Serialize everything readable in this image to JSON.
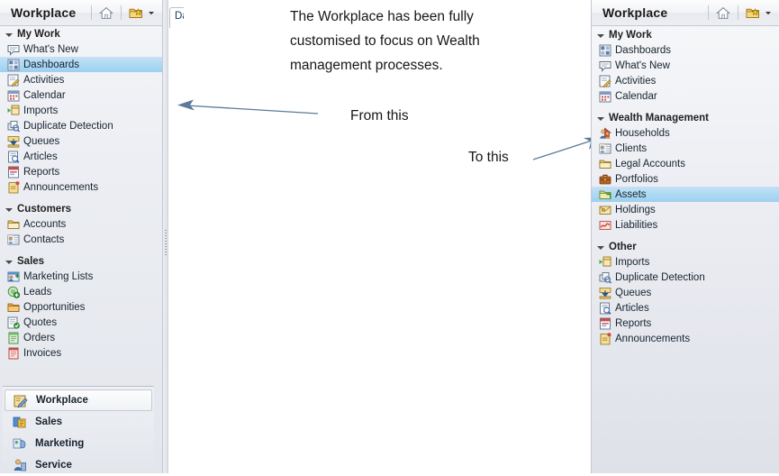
{
  "annotations": {
    "headline": "The Workplace has been fully\ncustomised to focus on Wealth\nmanagement processes.",
    "from_label": "From this",
    "to_label": "To this",
    "arrow_color": "#5b7b99"
  },
  "content_tab": {
    "label": "Dashboards"
  },
  "left_pane": {
    "header": {
      "title": "Workplace",
      "home_icon": "home-icon",
      "pin_icon": "pin-view-icon",
      "dropdown_icon": "chevron-down-icon"
    },
    "groups": [
      {
        "label": "My Work",
        "expanded": true,
        "items": [
          {
            "label": "What's New",
            "icon": "speech-bubble-icon",
            "selected": false
          },
          {
            "label": "Dashboards",
            "icon": "dashboard-grid-icon",
            "selected": true
          },
          {
            "label": "Activities",
            "icon": "activity-pencil-icon",
            "selected": false
          },
          {
            "label": "Calendar",
            "icon": "calendar-icon",
            "selected": false
          },
          {
            "label": "Imports",
            "icon": "import-icon",
            "selected": false
          },
          {
            "label": "Duplicate Detection",
            "icon": "duplicate-detection-icon",
            "selected": false
          },
          {
            "label": "Queues",
            "icon": "queues-icon",
            "selected": false
          },
          {
            "label": "Articles",
            "icon": "articles-icon",
            "selected": false
          },
          {
            "label": "Reports",
            "icon": "reports-icon",
            "selected": false
          },
          {
            "label": "Announcements",
            "icon": "announcements-icon",
            "selected": false
          }
        ]
      },
      {
        "label": "Customers",
        "expanded": true,
        "items": [
          {
            "label": "Accounts",
            "icon": "folder-accounts-icon",
            "selected": false
          },
          {
            "label": "Contacts",
            "icon": "contact-card-icon",
            "selected": false
          }
        ]
      },
      {
        "label": "Sales",
        "expanded": true,
        "items": [
          {
            "label": "Marketing Lists",
            "icon": "marketing-list-icon",
            "selected": false
          },
          {
            "label": "Leads",
            "icon": "leads-icon",
            "selected": false
          },
          {
            "label": "Opportunities",
            "icon": "opportunities-icon",
            "selected": false
          },
          {
            "label": "Quotes",
            "icon": "quotes-icon",
            "selected": false
          },
          {
            "label": "Orders",
            "icon": "orders-icon",
            "selected": false
          },
          {
            "label": "Invoices",
            "icon": "invoices-icon",
            "selected": false
          }
        ]
      }
    ],
    "launcher": [
      {
        "label": "Workplace",
        "icon": "workplace-icon",
        "selected": true
      },
      {
        "label": "Sales",
        "icon": "sales-module-icon",
        "selected": false
      },
      {
        "label": "Marketing",
        "icon": "marketing-module-icon",
        "selected": false
      },
      {
        "label": "Service",
        "icon": "service-module-icon",
        "selected": false
      }
    ]
  },
  "right_pane": {
    "header": {
      "title": "Workplace",
      "home_icon": "home-icon",
      "pin_icon": "pin-view-icon",
      "dropdown_icon": "chevron-down-icon"
    },
    "groups": [
      {
        "label": "My Work",
        "expanded": true,
        "items": [
          {
            "label": "Dashboards",
            "icon": "dashboard-grid-icon",
            "selected": false
          },
          {
            "label": "What's New",
            "icon": "speech-bubble-icon",
            "selected": false
          },
          {
            "label": "Activities",
            "icon": "activity-pencil-icon",
            "selected": false
          },
          {
            "label": "Calendar",
            "icon": "calendar-icon",
            "selected": false
          }
        ]
      },
      {
        "label": "Wealth Management",
        "expanded": true,
        "items": [
          {
            "label": "Households",
            "icon": "households-icon",
            "selected": false
          },
          {
            "label": "Clients",
            "icon": "contact-card-icon",
            "selected": false
          },
          {
            "label": "Legal Accounts",
            "icon": "folder-accounts-icon",
            "selected": false
          },
          {
            "label": "Portfolios",
            "icon": "portfolios-icon",
            "selected": false
          },
          {
            "label": "Assets",
            "icon": "assets-icon",
            "selected": true
          },
          {
            "label": "Holdings",
            "icon": "holdings-icon",
            "selected": false
          },
          {
            "label": "Liabilities",
            "icon": "liabilities-icon",
            "selected": false
          }
        ]
      },
      {
        "label": "Other",
        "expanded": true,
        "items": [
          {
            "label": "Imports",
            "icon": "import-icon",
            "selected": false
          },
          {
            "label": "Duplicate Detection",
            "icon": "duplicate-detection-icon",
            "selected": false
          },
          {
            "label": "Queues",
            "icon": "queues-icon",
            "selected": false
          },
          {
            "label": "Articles",
            "icon": "articles-icon",
            "selected": false
          },
          {
            "label": "Reports",
            "icon": "reports-icon",
            "selected": false
          },
          {
            "label": "Announcements",
            "icon": "announcements-icon",
            "selected": false
          }
        ]
      }
    ]
  }
}
